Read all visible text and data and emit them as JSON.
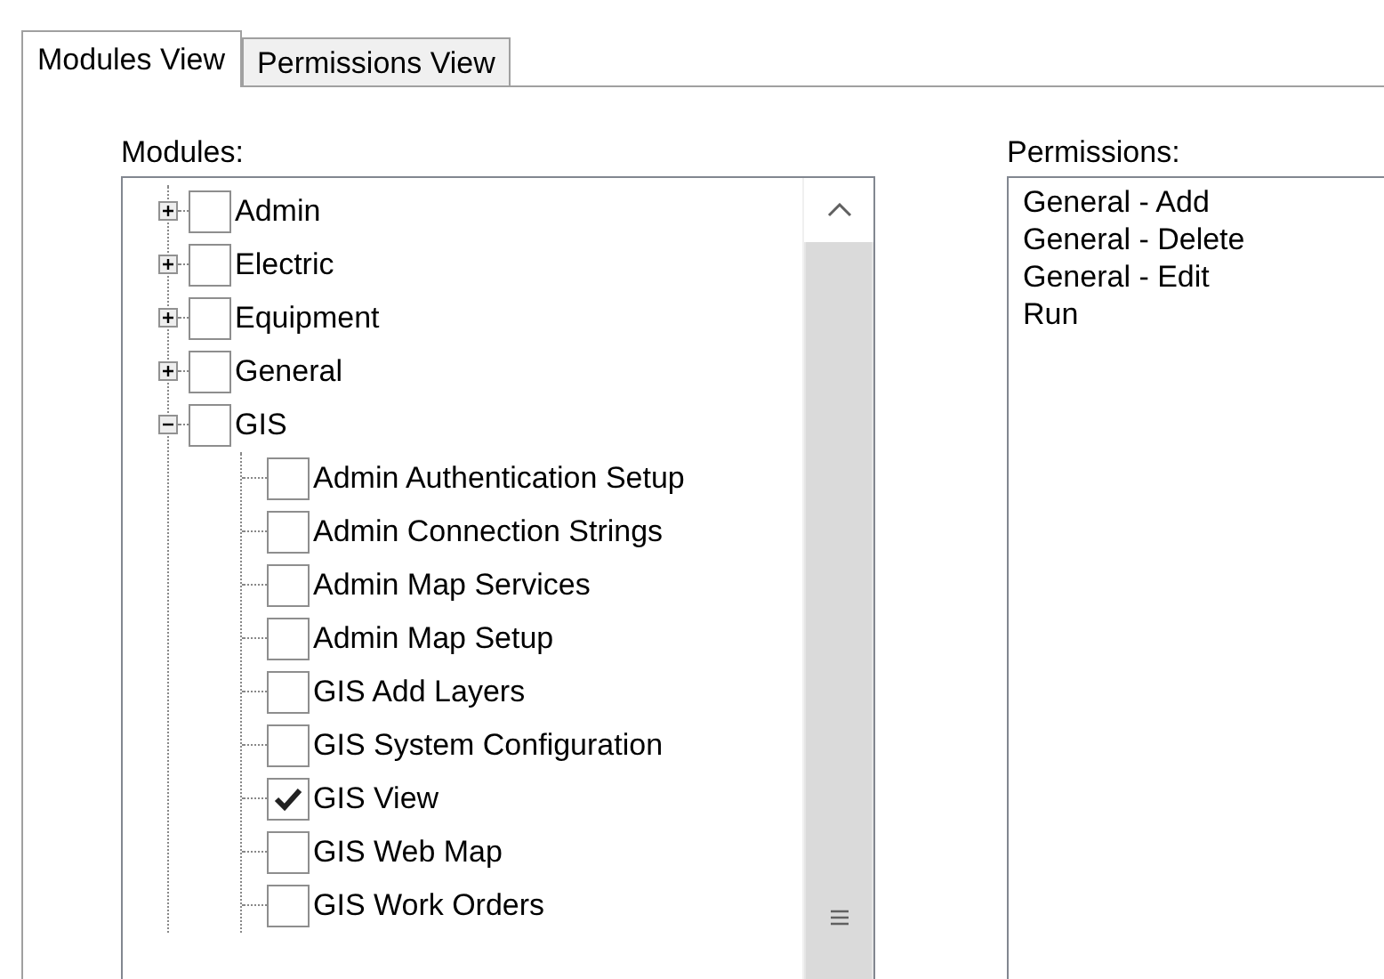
{
  "tabs": [
    {
      "label": "Modules View",
      "selected": true
    },
    {
      "label": "Permissions View",
      "selected": false
    }
  ],
  "modules": {
    "label": "Modules:",
    "tree": [
      {
        "label": "Admin",
        "expanded": false,
        "checked": false
      },
      {
        "label": "Electric",
        "expanded": false,
        "checked": false
      },
      {
        "label": "Equipment",
        "expanded": false,
        "checked": false
      },
      {
        "label": "General",
        "expanded": false,
        "checked": false
      },
      {
        "label": "GIS",
        "expanded": true,
        "checked": false,
        "children": [
          {
            "label": "Admin Authentication Setup",
            "checked": false
          },
          {
            "label": "Admin Connection Strings",
            "checked": false
          },
          {
            "label": "Admin Map Services",
            "checked": false
          },
          {
            "label": "Admin Map Setup",
            "checked": false
          },
          {
            "label": "GIS Add Layers",
            "checked": false
          },
          {
            "label": "GIS System Configuration",
            "checked": false
          },
          {
            "label": "GIS View",
            "checked": true
          },
          {
            "label": "GIS Web Map",
            "checked": false
          },
          {
            "label": "GIS Work Orders",
            "checked": false
          }
        ]
      }
    ]
  },
  "permissions": {
    "label": "Permissions:",
    "items": [
      "General - Add",
      "General - Delete",
      "General - Edit",
      "Run"
    ]
  }
}
